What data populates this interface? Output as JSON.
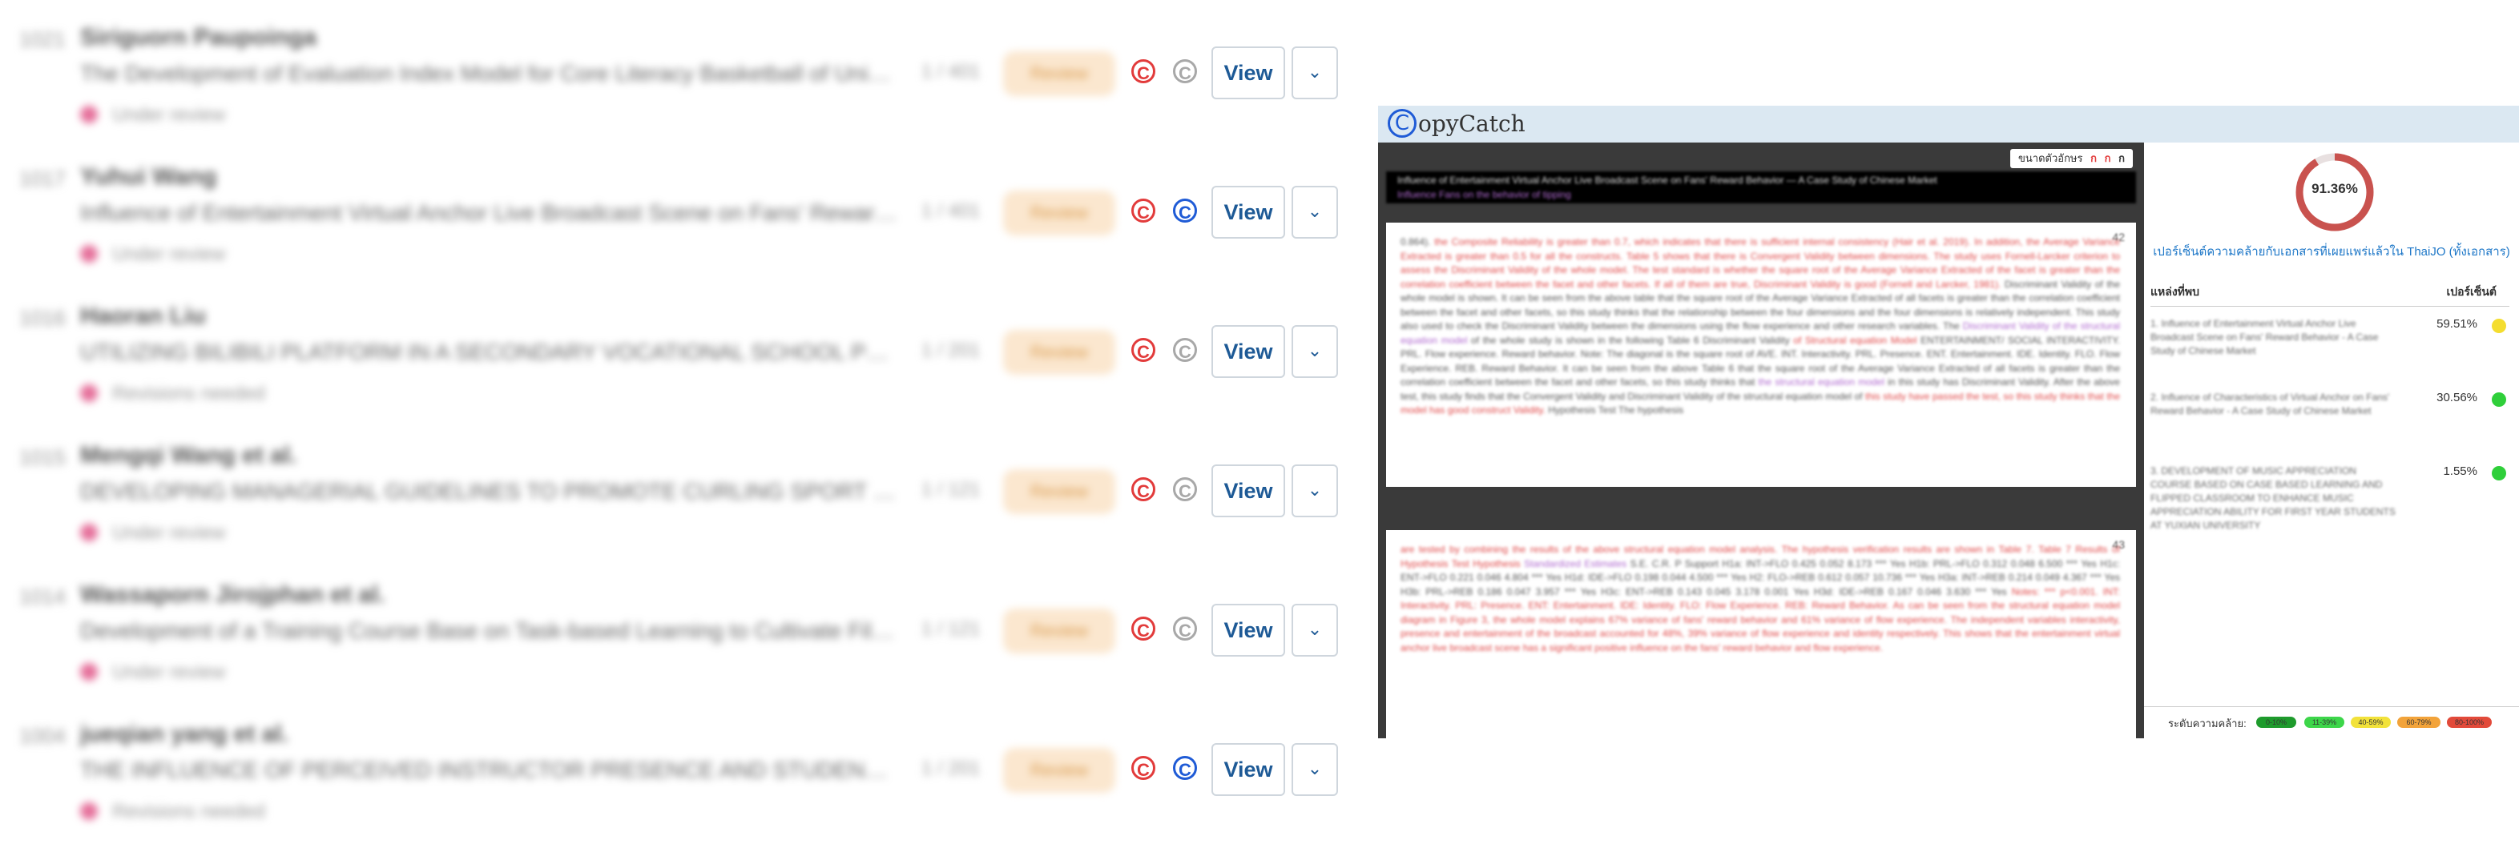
{
  "list": {
    "rows": [
      {
        "id": "1021",
        "author": "Siriguorn Paupoinga",
        "title": "The Development of Evaluation Index Model for Core Literacy Basketball of Universi...",
        "pages": "1 / 401",
        "status": "Under review",
        "review_label": "Review",
        "second_badge": "gray",
        "view_label": "View"
      },
      {
        "id": "1017",
        "author": "Yuhui Wang",
        "title": "Influence of Entertainment Virtual Anchor Live Broadcast Scene on Fans' Reward B...",
        "pages": "1 / 401",
        "status": "Under review",
        "review_label": "Review",
        "second_badge": "blue",
        "view_label": "View"
      },
      {
        "id": "1016",
        "author": "Haoran Liu",
        "title": "UTILIZING BILIBILI PLATFORM IN A SECONDARY VOCATIONAL SCHOOL POLITICS C...",
        "pages": "1 / 201",
        "status": "Revisions needed",
        "review_label": "Review",
        "second_badge": "gray",
        "view_label": "View"
      },
      {
        "id": "1015",
        "author": "Mengqi Wang et al.",
        "title": "DEVELOPING MANAGERIAL GUIDELINES TO PROMOTE CURLING SPORT IN THE PEO...",
        "pages": "1 / 121",
        "status": "Under review",
        "review_label": "Review",
        "second_badge": "gray",
        "view_label": "View"
      },
      {
        "id": "1014",
        "author": "Wassaporn Jirojphan et al.",
        "title": "Development of a Training Course Base on Task-based Learning to Cultivate Film A...",
        "pages": "1 / 121",
        "status": "Under review",
        "review_label": "Review",
        "second_badge": "gray",
        "view_label": "View"
      },
      {
        "id": "1004",
        "author": "jueqian yang et al.",
        "title": "THE INFLUENCE OF PERCEIVED INSTRUCTOR PRESENCE AND STUDENT SATISFACTI...",
        "pages": "1 / 201",
        "status": "Revisions needed",
        "review_label": "Review",
        "second_badge": "blue",
        "view_label": "View"
      }
    ]
  },
  "copycatch": {
    "logo_letter": "C",
    "logo_text": "opyCatch",
    "font_size_label": "ขนาดตัวอักษร",
    "font_size_options": [
      "ก",
      "ก",
      "ก"
    ],
    "doc_header_text": "Influence of Entertainment Virtual Anchor Live Broadcast Scene on Fans' Reward Behavior — A Case Study of Chinese Market",
    "doc_header_sub": "Influence Fans on the behavior of tipping",
    "page1_number": "42",
    "page2_number": "43",
    "page1_text_a": "0.864). ",
    "page1_text_b": "the Composite Reliability is greater than 0.7, which indicates that there is sufficient internal consistency (Hair et al. 2019). In addition, the Average Variance Extracted is greater than 0.5 for all the constructs. Table 5 shows that there is Convergent Validity between dimensions. The study uses Fornell-Larcker criterion to assess the Discriminant Validity of the whole model. The test standard is whether the square root of the Average Variance Extracted of the facet is greater than the correlation coefficient between the facet and other facets. If all of them are true, Discriminant Validity is good (Fornell and Larcker, 1981). ",
    "page1_text_c": "Discriminant Validity of the whole model is shown. It can be seen from the above table that the square root of the Average Variance Extracted of all facets is greater than the correlation coefficient between the facet and other facets, so this study thinks that the relationship between the four dimensions and the four dimensions is relatively independent. This study also used to check the Discriminant Validity between the dimensions using the flow experience and other research variables. The ",
    "page1_text_d": "Discriminant Validity of the structural equation model",
    "page1_text_e": " of the whole study is shown in the following Table 6 Discriminant Validity ",
    "page1_text_f": "of Structural equation Model",
    "page1_text_g": " ENTERTAINMENT/ SOCIAL INTERACTIVITY. PRL. Flow experience. Reward behavior. Note: The diagonal is the square root of AVE. INT. Interactivity. PRL. Presence. ENT. Entertainment. IDE. Identity. FLO. Flow Experience. REB. Reward Behavior. It can be seen from the above Table 6 that the square root of the Average Variance Extracted of all facets is greater than the correlation coefficient between the facet and other facets, so this study thinks that ",
    "page1_text_h": "the structural equation model",
    "page1_text_i": " in this study has Discriminant Validity. After the above test, this study finds that the Convergent Validity and Discriminant Validity of the structural equation model of ",
    "page1_text_j": "this study have passed the test, so this study thinks that the model has good construct Validity.",
    "page1_text_k": " Hypothesis Test The hypothesis",
    "page2_text_a": "are tested by combining the results of the above structural equation model analysis. The hypothesis verification results are shown in Table 7. Table 7 Results of Hypothesis Test Hypothesis ",
    "page2_text_b": "Standardized Estimates",
    "page2_text_c": " S.E. C.R. P Support H1a: INT->FLO 0.425 0.052 8.173 *** Yes H1b: PRL->FLO 0.312 0.048 6.500 *** Yes H1c: ENT->FLO 0.221 0.046 4.804 *** Yes H1d: IDE->FLO 0.198 0.044 4.500 *** Yes H2: FLO->REB 0.612 0.057 10.736 *** Yes H3a: INT->REB 0.214 0.049 4.367 *** Yes H3b: PRL->REB 0.186 0.047 3.957 *** Yes H3c: ENT->REB 0.143 0.045 3.178 0.001 Yes H3d: IDE->REB 0.167 0.046 3.630 *** Yes ",
    "page2_text_d": "Notes: *** p<0.001. INT: Interactivity. PRL: Presence. ENT: Entertainment. IDE: Identity. FLO: Flow Experience. REB: Reward Behavior. As can be seen from the structural equation model diagram in Figure 3, the whole model explains 67% variance of fans' reward behavior and 61% variance of flow experience. The independent variables interactivity, presence and entertainment of the broadcast accounted for 48%, 39% variance of flow experience and identity respectively. This shows that the entertainment virtual anchor live broadcast scene has a significant positive influence on the fans' reward behavior and flow experience.",
    "overall_percent": "91.36%",
    "overall_fraction": 0.9136,
    "overall_link_text": "เปอร์เซ็นต์ความคล้ายกับเอกสารที่เผยแพร่แล้วใน ThaiJO (ทั้งเอกสาร)",
    "col_source": "แหล่งที่พบ",
    "col_percent": "เปอร์เซ็นต์",
    "sources": [
      {
        "text": "1. Influence of Entertainment Virtual Anchor Live Broadcast Scene on Fans' Reward Behavior - A Case Study of Chinese Market",
        "percent": "59.51%",
        "color": "#f4dd2f"
      },
      {
        "text": "2. Influence of Characteristics of Virtual Anchor on Fans' Reward Behavior - A Case Study of Chinese Market",
        "percent": "30.56%",
        "color": "#2fcf3a"
      },
      {
        "text": "3. DEVELOPMENT OF MUSIC APPRECIATION COURSE BASED ON CASE BASED LEARNING AND FLIPPED CLASSROOM TO ENHANCE MUSIC APPRECIATION ABILITY FOR FIRST YEAR STUDENTS AT YUXIAN UNIVERSITY",
        "percent": "1.55%",
        "color": "#2fcf3a"
      }
    ],
    "legend_label": "ระดับความคล้าย:",
    "legend": [
      {
        "label": "0-10%",
        "color": "#1e9b2c"
      },
      {
        "label": "11-39%",
        "color": "#3dd64a"
      },
      {
        "label": "40-59%",
        "color": "#f2e23a"
      },
      {
        "label": "60-79%",
        "color": "#f2a33a"
      },
      {
        "label": "80-100%",
        "color": "#e24a3a"
      }
    ]
  }
}
